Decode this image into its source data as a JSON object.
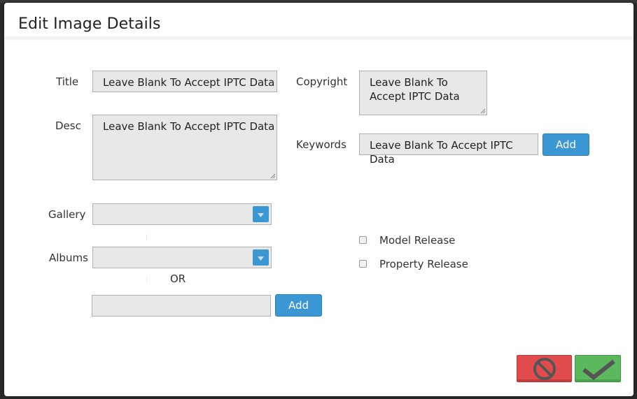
{
  "dialog": {
    "title": "Edit Image Details"
  },
  "form": {
    "title_label": "Title",
    "title_placeholder": "Leave Blank To Accept IPTC Data",
    "desc_label": "Desc",
    "desc_placeholder": "Leave Blank To Accept IPTC Data",
    "copyright_label": "Copyright",
    "copyright_placeholder": "Leave Blank To Accept IPTC Data",
    "keywords_label": "Keywords",
    "keywords_placeholder": "Leave Blank To Accept IPTC Data",
    "keywords_add": "Add",
    "gallery_label": "Gallery",
    "gallery_value": "",
    "albums_label": "Albums",
    "albums_value": "",
    "or_text": "OR",
    "new_album_value": "",
    "new_album_add": "Add",
    "model_release_label": "Model Release",
    "property_release_label": "Property Release"
  },
  "footer": {
    "cancel_icon": "cancel-circle-icon",
    "confirm_icon": "checkmark-icon"
  },
  "colors": {
    "primary_button": "#3b97d3",
    "cancel_button": "#e14b4b",
    "confirm_button": "#5cb85c",
    "field_bg": "#e8e8e8"
  }
}
